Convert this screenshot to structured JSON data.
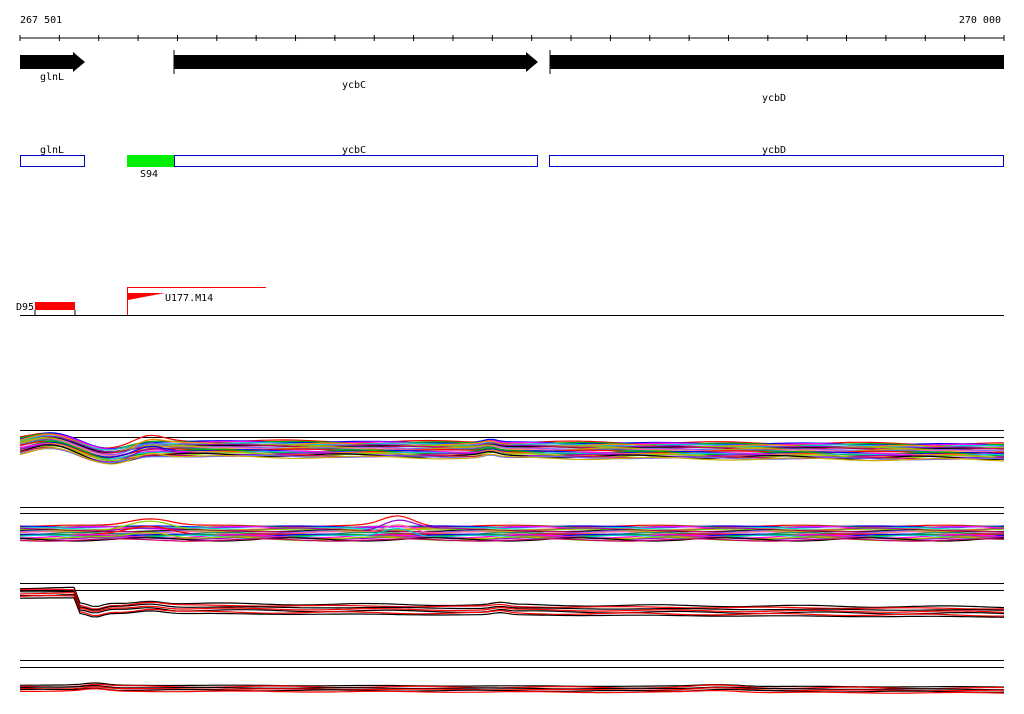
{
  "coordinates": {
    "start": "267 501",
    "end": "270 000"
  },
  "genes": [
    {
      "name": "glnL",
      "label": "glnL"
    },
    {
      "name": "ycbC",
      "label": "ycbC"
    },
    {
      "name": "ycbD",
      "label": "ycbD"
    }
  ],
  "annotation_boxes": [
    {
      "label": "glnL"
    },
    {
      "label": "ycbC"
    },
    {
      "label": "ycbD"
    }
  ],
  "features": {
    "green_label": "S94",
    "red_left_label": "D95",
    "red_flag_label": "U177.M14"
  },
  "colors": {
    "gene_arrow": "#000000",
    "annotation_box": "#0000cc",
    "green_feature": "#00ee00",
    "red_feature": "#ff0000",
    "track_palette": [
      "#ff0000",
      "#0000ff",
      "#00aa00",
      "#ff00ff",
      "#00cccc",
      "#ff8800",
      "#9900cc",
      "#88cc00",
      "#000000",
      "#cc0066",
      "#6666ff",
      "#ccaa00",
      "#ff66aa",
      "#009966"
    ]
  },
  "tracks": [
    {
      "name": "expression-track-1",
      "style": "multicolor"
    },
    {
      "name": "expression-track-2",
      "style": "multicolor"
    },
    {
      "name": "expression-track-3",
      "style": "red-black"
    },
    {
      "name": "expression-track-4",
      "style": "red-black"
    }
  ]
}
